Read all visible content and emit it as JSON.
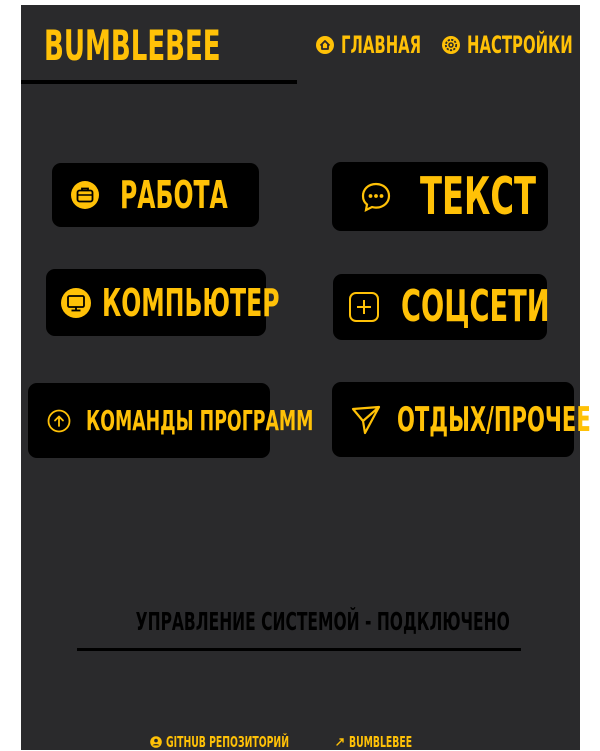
{
  "app": {
    "title": "BUMBLEBEE"
  },
  "nav": [
    {
      "label": "ГЛАВНАЯ",
      "icon": "home-icon"
    },
    {
      "label": "НАСТРОЙКИ",
      "icon": "gear-icon"
    }
  ],
  "tiles": [
    {
      "label": "РАБОТА",
      "icon": "briefcase-icon"
    },
    {
      "label": "ТЕКСТ",
      "icon": "chat-bubble-icon"
    },
    {
      "label": "КОМПЬЮТЕР",
      "icon": "monitor-icon"
    },
    {
      "label": "СОЦСЕТИ",
      "icon": "plus-square-icon"
    },
    {
      "label": "КОМАНДЫ ПРОГРАММ",
      "icon": "arrow-up-circle-icon"
    },
    {
      "label": "ОТДЫХ/ПРОЧЕЕ",
      "icon": "send-icon"
    }
  ],
  "status": {
    "text": "УПРАВЛЕНИЕ СИСТЕМОЙ - ПОДКЛЮЧЕНО"
  },
  "footer": {
    "github_label": "GITHUB РЕПОЗИТОРИЙ",
    "app_label": "BUMBLEBEE"
  },
  "colors": {
    "accent": "#ffc107",
    "background": "#2a2a2c",
    "tile": "#000000"
  }
}
